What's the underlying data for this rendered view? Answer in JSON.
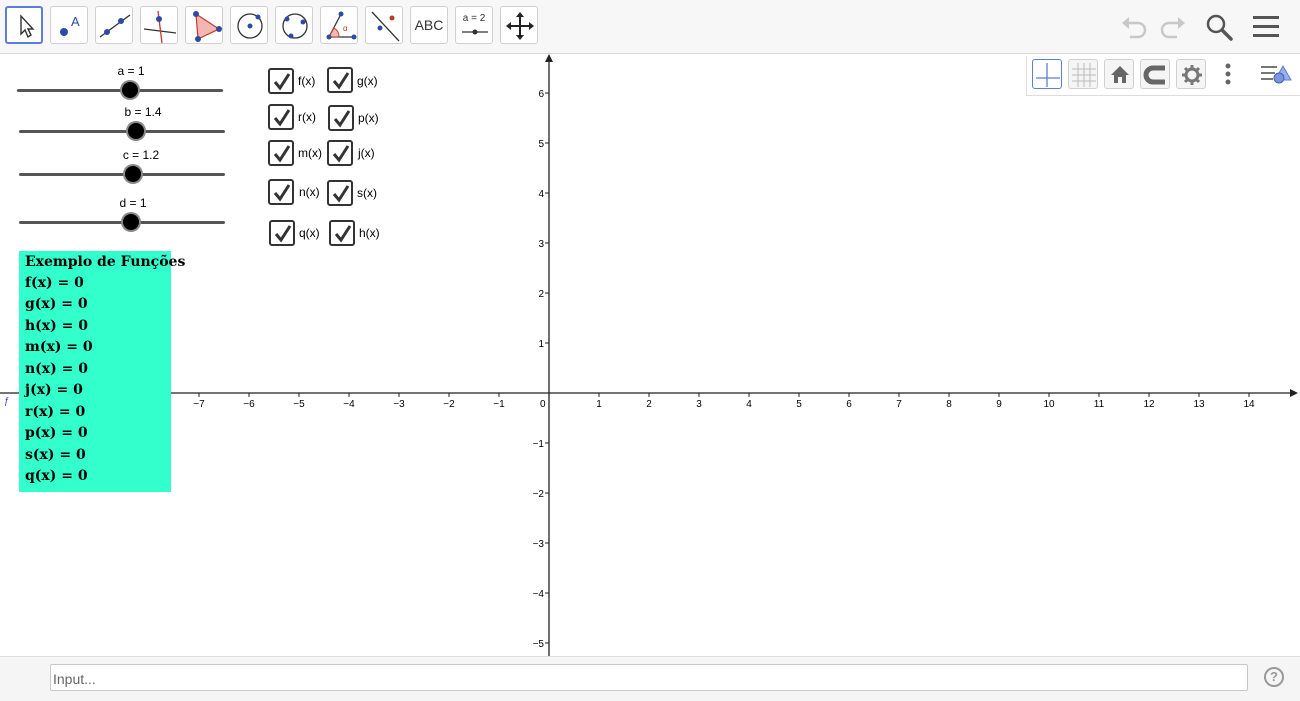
{
  "toolbar": {
    "tools": [
      {
        "name": "move-tool"
      },
      {
        "name": "point-tool",
        "label": "A"
      },
      {
        "name": "line-tool"
      },
      {
        "name": "perpendicular-line-tool"
      },
      {
        "name": "polygon-tool"
      },
      {
        "name": "circle-center-point-tool"
      },
      {
        "name": "circle-three-points-tool"
      },
      {
        "name": "angle-tool",
        "label": "α"
      },
      {
        "name": "reflect-tool"
      },
      {
        "name": "text-tool",
        "label": "ABC"
      },
      {
        "name": "slider-tool",
        "label": "a = 2"
      },
      {
        "name": "move-graphics-view-tool"
      }
    ],
    "right_icons": [
      "undo-icon",
      "redo-icon",
      "search-icon",
      "menu-icon"
    ]
  },
  "graphics_toolbar": {
    "icons": [
      "axes-icon",
      "grid-icon",
      "home-icon",
      "magnet-icon",
      "gear-icon",
      "more-icon",
      "style-bar-icon"
    ]
  },
  "sliders": [
    {
      "label": "a = 1",
      "min": -5,
      "max": 5,
      "value": 1
    },
    {
      "label": "b = 1.4",
      "min": -5,
      "max": 5,
      "value": 1.4
    },
    {
      "label": "c = 1.2",
      "min": -5,
      "max": 5,
      "value": 1.2
    },
    {
      "label": "d = 1",
      "min": -5,
      "max": 5,
      "value": 1
    }
  ],
  "checkboxes": [
    {
      "label": "f(x)",
      "checked": true
    },
    {
      "label": "g(x)",
      "checked": true
    },
    {
      "label": "r(x)",
      "checked": true
    },
    {
      "label": "p(x)",
      "checked": true
    },
    {
      "label": "m(x)",
      "checked": true
    },
    {
      "label": "j(x)",
      "checked": true
    },
    {
      "label": "n(x)",
      "checked": true
    },
    {
      "label": "s(x)",
      "checked": true
    },
    {
      "label": "q(x)",
      "checked": true
    },
    {
      "label": "h(x)",
      "checked": true
    }
  ],
  "info_box": {
    "title": "Exemplo de Funções",
    "lines": [
      "f(x) = 0",
      "g(x) = 0",
      "h(x) = 0",
      "m(x) = 0",
      "n(x) = 0",
      "j(x) = 0",
      "r(x) = 0",
      "p(x) = 0",
      "s(x) = 0",
      "q(x) = 0"
    ],
    "color": "#33ffcc"
  },
  "axes": {
    "x_ticks": [
      "−7",
      "−6",
      "−5",
      "−4",
      "−3",
      "−2",
      "−1",
      "0",
      "1",
      "2",
      "3",
      "4",
      "5",
      "6",
      "7",
      "8",
      "9",
      "10",
      "11",
      "12",
      "13",
      "14"
    ],
    "y_ticks": [
      "6",
      "5",
      "4",
      "3",
      "2",
      "1",
      "−1",
      "−2",
      "−3",
      "−4",
      "−5"
    ],
    "y_values": [
      6,
      5,
      4,
      3,
      2,
      1,
      -1,
      -2,
      -3,
      -4,
      -5
    ]
  },
  "left_edge_marker": "ƒ",
  "input_bar": {
    "placeholder": "Input...",
    "help_label": "?"
  }
}
